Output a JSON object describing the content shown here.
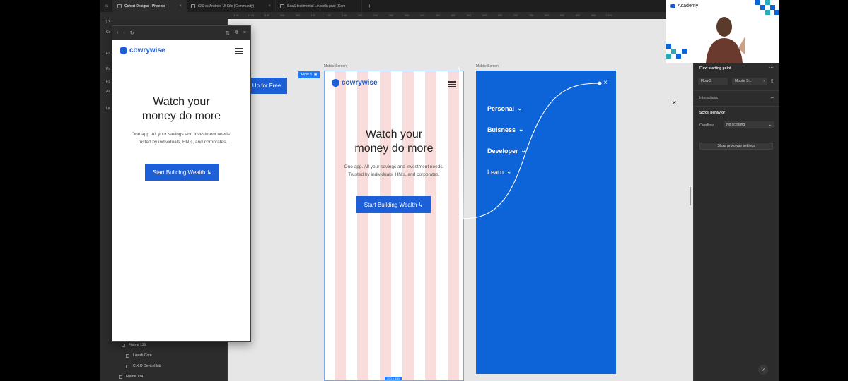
{
  "tabs": [
    {
      "label": "Cohort Designs - Phoenix",
      "active": true
    },
    {
      "label": "iOS vs Android UI Kits (Community)",
      "active": false
    },
    {
      "label": "SaaS testimonial LinkedIn post (Com",
      "active": false
    }
  ],
  "ruler_ticks": [
    "1166",
    "1140",
    "1180",
    "300",
    "360",
    "100",
    "120",
    "140",
    "200",
    "240",
    "280",
    "360",
    "400",
    "460",
    "500",
    "501",
    "600",
    "650",
    "700",
    "750",
    "800",
    "850",
    "900",
    "950",
    "1000"
  ],
  "left_panel": {
    "letters": [
      "Co",
      "Pa",
      "Pa",
      "Pa",
      "As",
      "Le"
    ],
    "layers": [
      "Frame 136",
      "Lavish Core",
      "C.X.O DeviceHub",
      "Frame 134"
    ]
  },
  "preview": {
    "logo": "cowrywise",
    "title_line1": "Watch your",
    "title_line2": "money do more",
    "subtitle": "One app. All your savings and investment needs. Trusted by individuals, HNIs, and corporates.",
    "cta": "Start Building Wealth ↳"
  },
  "canvas": {
    "signup_button": "Up for Free",
    "flow_tag": "Flow 3",
    "frame1_label": "Mobile Screen",
    "frame2_label": "Mobile Screen",
    "frame_size": "200 × 450",
    "menu": [
      "Personal",
      "Buisness",
      "Developer",
      "Learn"
    ]
  },
  "right_panel": {
    "flow_heading": "Flow starting point",
    "flow_name": "Flow 3",
    "flow_target": "Mobile S...",
    "interactions": "Interactions",
    "scroll_heading": "Scroll behavior",
    "overflow_label": "Overflow",
    "overflow_value": "No scrolling",
    "prototype_button": "Show prototype settings"
  },
  "webcam": {
    "brand": "Academy"
  },
  "help": "?",
  "colors": {
    "brand_blue": "#1d5fd6",
    "frame_blue": "#0d63d8",
    "grid_pink": "#f9dcdc",
    "figma_dark": "#2c2c2c"
  }
}
